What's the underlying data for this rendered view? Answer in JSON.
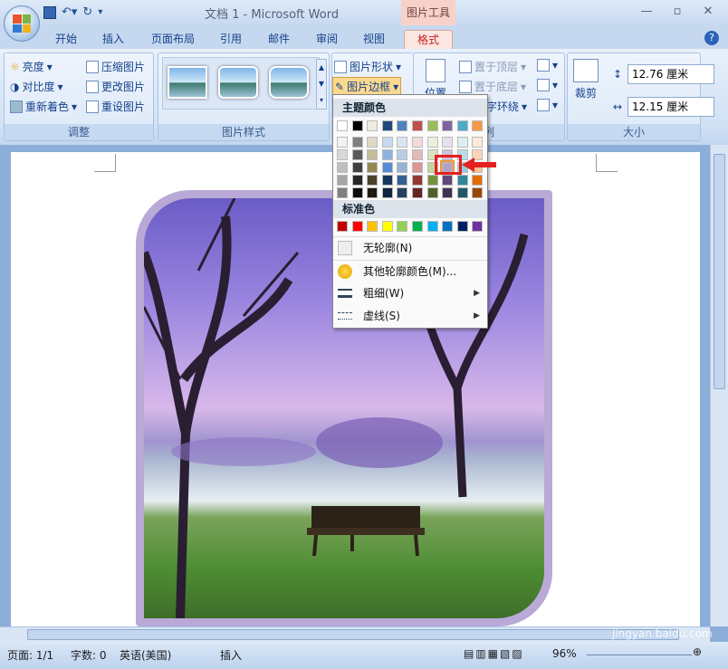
{
  "window": {
    "title": "文档 1 - Microsoft Word",
    "context_tab_header": "图片工具"
  },
  "qat": {
    "save": "save-icon",
    "undo": "undo-icon",
    "redo": "redo-icon"
  },
  "tabs": [
    "开始",
    "插入",
    "页面布局",
    "引用",
    "邮件",
    "审阅",
    "视图",
    "格式"
  ],
  "ribbon": {
    "adjust": {
      "label": "调整",
      "brightness": "亮度",
      "contrast": "对比度",
      "recolor": "重新着色",
      "compress": "压缩图片",
      "change": "更改图片",
      "reset": "重设图片"
    },
    "styles": {
      "label": "图片样式",
      "shape": "图片形状",
      "border": "图片边框"
    },
    "arrange": {
      "label": "列",
      "position": "位置",
      "front": "置于顶层",
      "back": "置于底层",
      "wrap": "字环绕"
    },
    "size": {
      "label": "大小",
      "crop": "裁剪",
      "height": "12.76 厘米",
      "width": "12.15 厘米"
    }
  },
  "dropdown": {
    "theme_colors_title": "主题颜色",
    "standard_colors_title": "标准色",
    "no_outline": "无轮廓(N)",
    "more_colors": "其他轮廓颜色(M)...",
    "weight": "粗细(W)",
    "dashes": "虚线(S)",
    "theme_top_row": [
      "#ffffff",
      "#000000",
      "#eeece1",
      "#1f497d",
      "#4f81bd",
      "#c0504d",
      "#9bbb59",
      "#8064a2",
      "#4bacc6",
      "#f79646"
    ],
    "theme_shades": [
      [
        "#f2f2f2",
        "#7f7f7f",
        "#ddd9c3",
        "#c6d9f0",
        "#dbe5f1",
        "#f2dcdb",
        "#ebf1dd",
        "#e5e0ec",
        "#dbeef3",
        "#fdeada"
      ],
      [
        "#d8d8d8",
        "#595959",
        "#c4bd97",
        "#8db3e2",
        "#b8cce4",
        "#e5b9b7",
        "#d7e3bc",
        "#ccc1d9",
        "#b7dde8",
        "#fbd5b5"
      ],
      [
        "#bfbfbf",
        "#3f3f3f",
        "#938953",
        "#548dd4",
        "#95b3d7",
        "#d99694",
        "#c3d69b",
        "#b2a2c7",
        "#92cddc",
        "#fac08f"
      ],
      [
        "#a5a5a5",
        "#262626",
        "#494429",
        "#17365d",
        "#366092",
        "#953734",
        "#76923c",
        "#5f497a",
        "#31859b",
        "#e36c09"
      ],
      [
        "#7f7f7f",
        "#0c0c0c",
        "#1d1b10",
        "#0f243e",
        "#244061",
        "#632423",
        "#4f6128",
        "#3f3151",
        "#205867",
        "#974806"
      ]
    ],
    "standard": [
      "#c00000",
      "#ff0000",
      "#ffc000",
      "#ffff00",
      "#92d050",
      "#00b050",
      "#00b0f0",
      "#0070c0",
      "#002060",
      "#7030a0"
    ]
  },
  "status": {
    "page": "页面: 1/1",
    "words": "字数: 0",
    "lang": "英语(美国)",
    "mode": "插入",
    "zoom": "96%"
  },
  "watermark": {
    "main": "Baidu经验",
    "sub": "jingyan.baidu.com"
  }
}
